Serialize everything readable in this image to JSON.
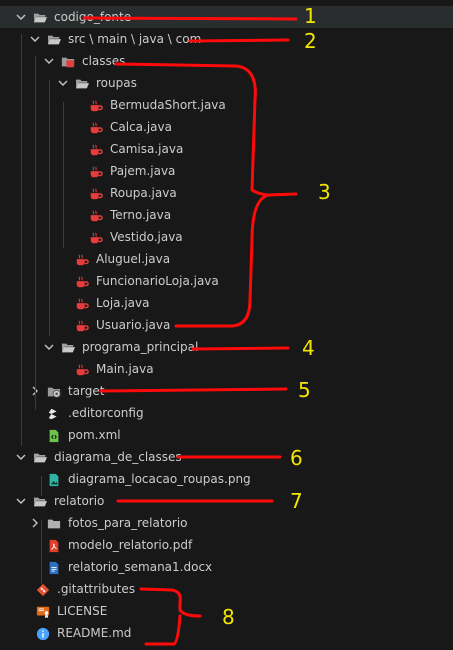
{
  "explorer": {
    "items": [
      {
        "label": "codigo_fonte",
        "type": "folder",
        "expanded": true,
        "depth": 0,
        "icon": "folder-open-icon"
      },
      {
        "label": "src \\ main \\ java \\ com",
        "type": "folder",
        "expanded": true,
        "depth": 1,
        "icon": "folder-open-icon"
      },
      {
        "label": "classes",
        "type": "folder",
        "expanded": true,
        "depth": 2,
        "icon": "folder-classes-icon"
      },
      {
        "label": "roupas",
        "type": "folder",
        "expanded": true,
        "depth": 3,
        "icon": "folder-open-icon"
      },
      {
        "label": "BermudaShort.java",
        "type": "file",
        "depth": 4,
        "icon": "java-icon"
      },
      {
        "label": "Calca.java",
        "type": "file",
        "depth": 4,
        "icon": "java-icon"
      },
      {
        "label": "Camisa.java",
        "type": "file",
        "depth": 4,
        "icon": "java-icon"
      },
      {
        "label": "Pajem.java",
        "type": "file",
        "depth": 4,
        "icon": "java-icon"
      },
      {
        "label": "Roupa.java",
        "type": "file",
        "depth": 4,
        "icon": "java-icon"
      },
      {
        "label": "Terno.java",
        "type": "file",
        "depth": 4,
        "icon": "java-icon"
      },
      {
        "label": "Vestido.java",
        "type": "file",
        "depth": 4,
        "icon": "java-icon"
      },
      {
        "label": "Aluguel.java",
        "type": "file",
        "depth": 3,
        "icon": "java-icon"
      },
      {
        "label": "FuncionarioLoja.java",
        "type": "file",
        "depth": 3,
        "icon": "java-icon"
      },
      {
        "label": "Loja.java",
        "type": "file",
        "depth": 3,
        "icon": "java-icon"
      },
      {
        "label": "Usuario.java",
        "type": "file",
        "depth": 3,
        "icon": "java-icon"
      },
      {
        "label": "programa_principal",
        "type": "folder",
        "expanded": true,
        "depth": 2,
        "icon": "folder-open-icon"
      },
      {
        "label": "Main.java",
        "type": "file",
        "depth": 3,
        "icon": "java-icon"
      },
      {
        "label": "target",
        "type": "folder",
        "expanded": false,
        "depth": 1,
        "icon": "folder-target-icon"
      },
      {
        "label": ".editorconfig",
        "type": "file",
        "depth": 1,
        "icon": "editorconfig-icon"
      },
      {
        "label": "pom.xml",
        "type": "file",
        "depth": 1,
        "icon": "xml-icon"
      },
      {
        "label": "diagrama_de_classes",
        "type": "folder",
        "expanded": true,
        "depth": 0,
        "icon": "folder-open-icon"
      },
      {
        "label": "diagrama_locacao_roupas.png",
        "type": "file",
        "depth": 1,
        "icon": "image-icon"
      },
      {
        "label": "relatorio",
        "type": "folder",
        "expanded": true,
        "depth": 0,
        "icon": "folder-open-icon"
      },
      {
        "label": "fotos_para_relatorio",
        "type": "folder",
        "expanded": false,
        "depth": 1,
        "icon": "folder-icon"
      },
      {
        "label": "modelo_relatorio.pdf",
        "type": "file",
        "depth": 1,
        "icon": "pdf-icon"
      },
      {
        "label": "relatorio_semana1.docx",
        "type": "file",
        "depth": 1,
        "icon": "docx-icon"
      },
      {
        "label": ".gitattributes",
        "type": "file",
        "depth": -1,
        "icon": "git-icon"
      },
      {
        "label": "LICENSE",
        "type": "file",
        "depth": -1,
        "icon": "license-icon"
      },
      {
        "label": "README.md",
        "type": "file",
        "depth": -1,
        "icon": "info-icon"
      }
    ]
  },
  "annotations": {
    "numbers": [
      "1",
      "2",
      "3",
      "4",
      "5",
      "6",
      "7",
      "8"
    ],
    "ink_color": "#ff0a0a",
    "number_color": "#f2e600"
  }
}
